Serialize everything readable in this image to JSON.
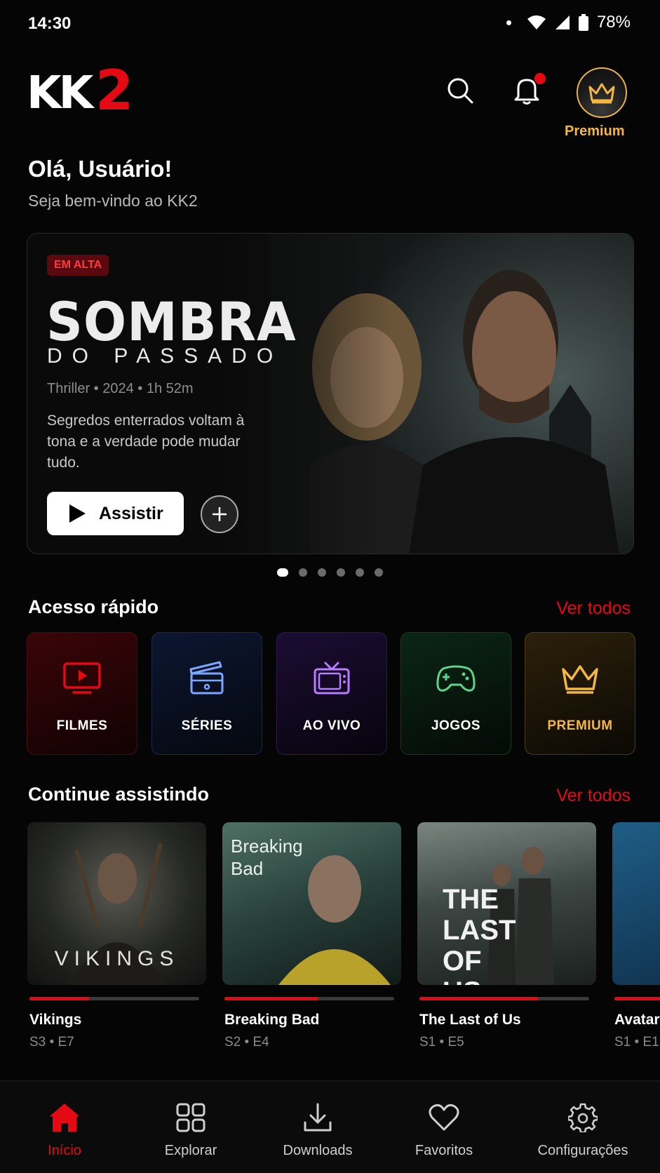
{
  "status_bar": {
    "time": "14:30",
    "battery": "78%"
  },
  "header": {
    "logo_text": "KK2",
    "premium_label": "Premium",
    "notification_dot": true
  },
  "greeting": {
    "title": "Olá, Usuário!",
    "subtitle": "Seja bem-vindo ao KK2"
  },
  "hero": {
    "badge": "EM ALTA",
    "title": "SOMBRA",
    "subtitle": "DO PASSADO",
    "meta": "Thriller • 2024 • 1h 52m",
    "description": "Segredos enterrados voltam à tona e a verdade pode mudar tudo.",
    "watch_label": "Assistir",
    "carousel_total": 6,
    "carousel_active": 1
  },
  "quick_access": {
    "title": "Acesso rápido",
    "see_all": "Ver todos",
    "items": [
      {
        "label": "FILMES",
        "icon": "tv-play-icon",
        "color": "#e50914"
      },
      {
        "label": "SÉRIES",
        "icon": "clapperboard-icon",
        "color": "#7aa7ff"
      },
      {
        "label": "AO VIVO",
        "icon": "retro-tv-icon",
        "color": "#b77cff"
      },
      {
        "label": "JOGOS",
        "icon": "gamepad-icon",
        "color": "#5fd38a"
      },
      {
        "label": "PREMIUM",
        "icon": "crown-icon",
        "color": "#f3b742"
      }
    ]
  },
  "continue_watching": {
    "title": "Continue assistindo",
    "see_all": "Ver todos",
    "items": [
      {
        "name": "Vikings",
        "episode": "S3 • E7",
        "progress": 0.35,
        "thumb_text": "VIKINGS"
      },
      {
        "name": "Breaking Bad",
        "episode": "S2 • E4",
        "progress": 0.55,
        "thumb_text": "Breaking Bad"
      },
      {
        "name": "The Last of Us",
        "episode": "S1 • E5",
        "progress": 0.7,
        "thumb_text": "THE LAST OF US"
      },
      {
        "name": "Avatar",
        "episode": "S1 • E1",
        "progress": 0.4,
        "thumb_text": ""
      }
    ]
  },
  "bottom_nav": {
    "items": [
      {
        "label": "Início",
        "icon": "home-icon",
        "active": true
      },
      {
        "label": "Explorar",
        "icon": "grid-icon",
        "active": false
      },
      {
        "label": "Downloads",
        "icon": "download-icon",
        "active": false
      },
      {
        "label": "Favoritos",
        "icon": "heart-icon",
        "active": false
      },
      {
        "label": "Configurações",
        "icon": "gear-icon",
        "active": false
      }
    ]
  },
  "colors": {
    "accent": "#e50914",
    "gold": "#f3b742",
    "background": "#050505"
  }
}
